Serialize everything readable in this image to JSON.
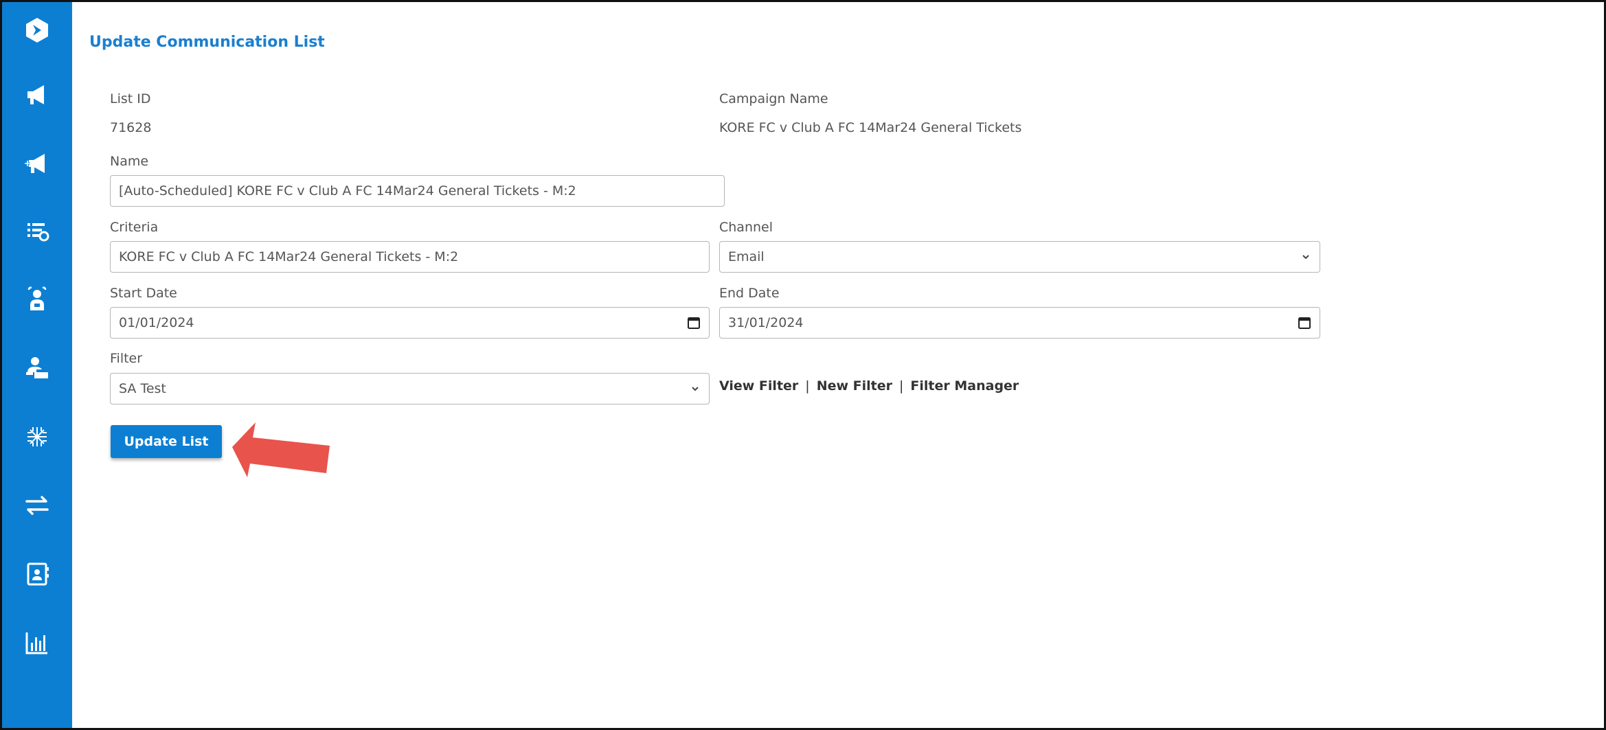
{
  "page": {
    "title": "Update Communication List"
  },
  "colors": {
    "accent": "#0c7fd3",
    "title": "#1a7fd0",
    "annotation_arrow": "#e8534c"
  },
  "sidebar": {
    "items": [
      {
        "icon": "logo-icon"
      },
      {
        "icon": "megaphone-icon"
      },
      {
        "icon": "megaphone-add-icon"
      },
      {
        "icon": "list-settings-icon"
      },
      {
        "icon": "user-support-icon"
      },
      {
        "icon": "user-desk-icon"
      },
      {
        "icon": "snowflake-grid-icon"
      },
      {
        "icon": "transfer-arrows-icon"
      },
      {
        "icon": "contact-book-icon"
      },
      {
        "icon": "bar-chart-icon"
      }
    ]
  },
  "form": {
    "list_id": {
      "label": "List ID",
      "value": "71628"
    },
    "campaign_name": {
      "label": "Campaign Name",
      "value": "KORE FC v Club A FC 14Mar24 General Tickets"
    },
    "name": {
      "label": "Name",
      "value": "[Auto-Scheduled] KORE FC v Club A FC 14Mar24 General Tickets - M:2"
    },
    "criteria": {
      "label": "Criteria",
      "value": "KORE FC v Club A FC 14Mar24 General Tickets - M:2"
    },
    "channel": {
      "label": "Channel",
      "value": "Email"
    },
    "start_date": {
      "label": "Start Date",
      "value": "01/01/2024"
    },
    "end_date": {
      "label": "End Date",
      "value": "31/01/2024"
    },
    "filter": {
      "label": "Filter",
      "value": "SA Test"
    }
  },
  "filter_links": {
    "view": "View Filter",
    "new": "New Filter",
    "manager": "Filter Manager",
    "separator": "|"
  },
  "actions": {
    "update_label": "Update List"
  }
}
